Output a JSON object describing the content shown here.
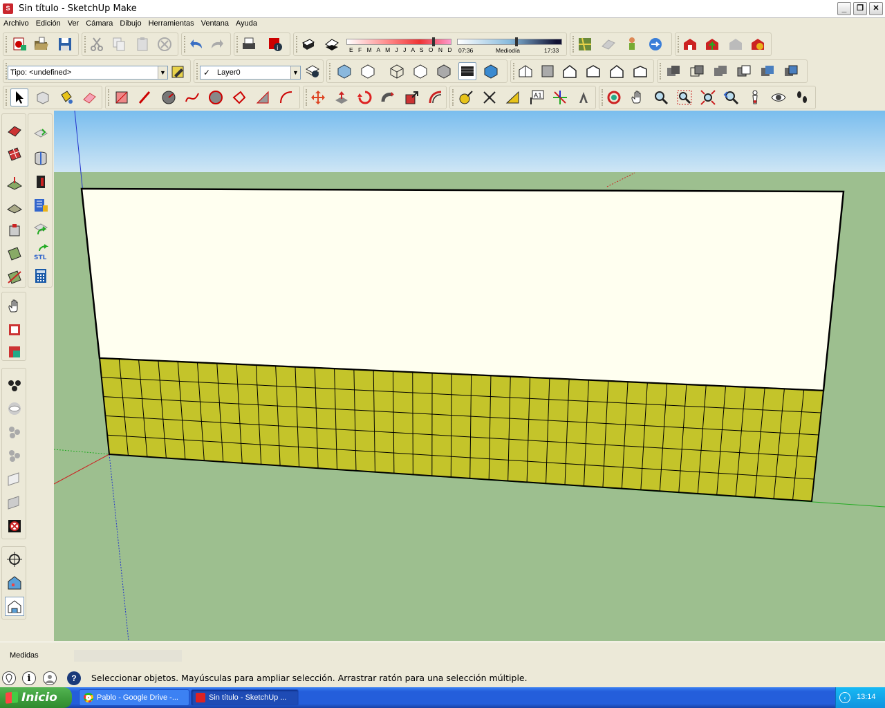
{
  "window": {
    "title": "Sin título - SketchUp Make",
    "buttons": {
      "minimize": "_",
      "maximize": "❐",
      "close": "✕"
    }
  },
  "menu": [
    "Archivo",
    "Edición",
    "Ver",
    "Cámara",
    "Dibujo",
    "Herramientas",
    "Ventana",
    "Ayuda"
  ],
  "shadows": {
    "months": "E F M A M J J A S O N D",
    "time_start": "07:36",
    "time_mid": "Mediodía",
    "time_end": "17:33"
  },
  "style_select": {
    "value": "Tipo: <undefined>"
  },
  "layer_select": {
    "value": "Layer0",
    "check": "✓"
  },
  "measurements": {
    "label": "Medidas",
    "value": ""
  },
  "status": {
    "message": "Seleccionar objetos. Mayúsculas para ampliar selección. Arrastrar ratón para una selección múltiple."
  },
  "taskbar": {
    "start": "Inicio",
    "tasks": [
      {
        "label": "Pablo - Google Drive -..."
      },
      {
        "label": "Sin título - SketchUp ..."
      }
    ],
    "clock": "13:14"
  },
  "colors": {
    "sky": "#87c6f0",
    "ground": "#9dbf8f",
    "tile": "#c4c42a",
    "face": "#ffffee"
  }
}
